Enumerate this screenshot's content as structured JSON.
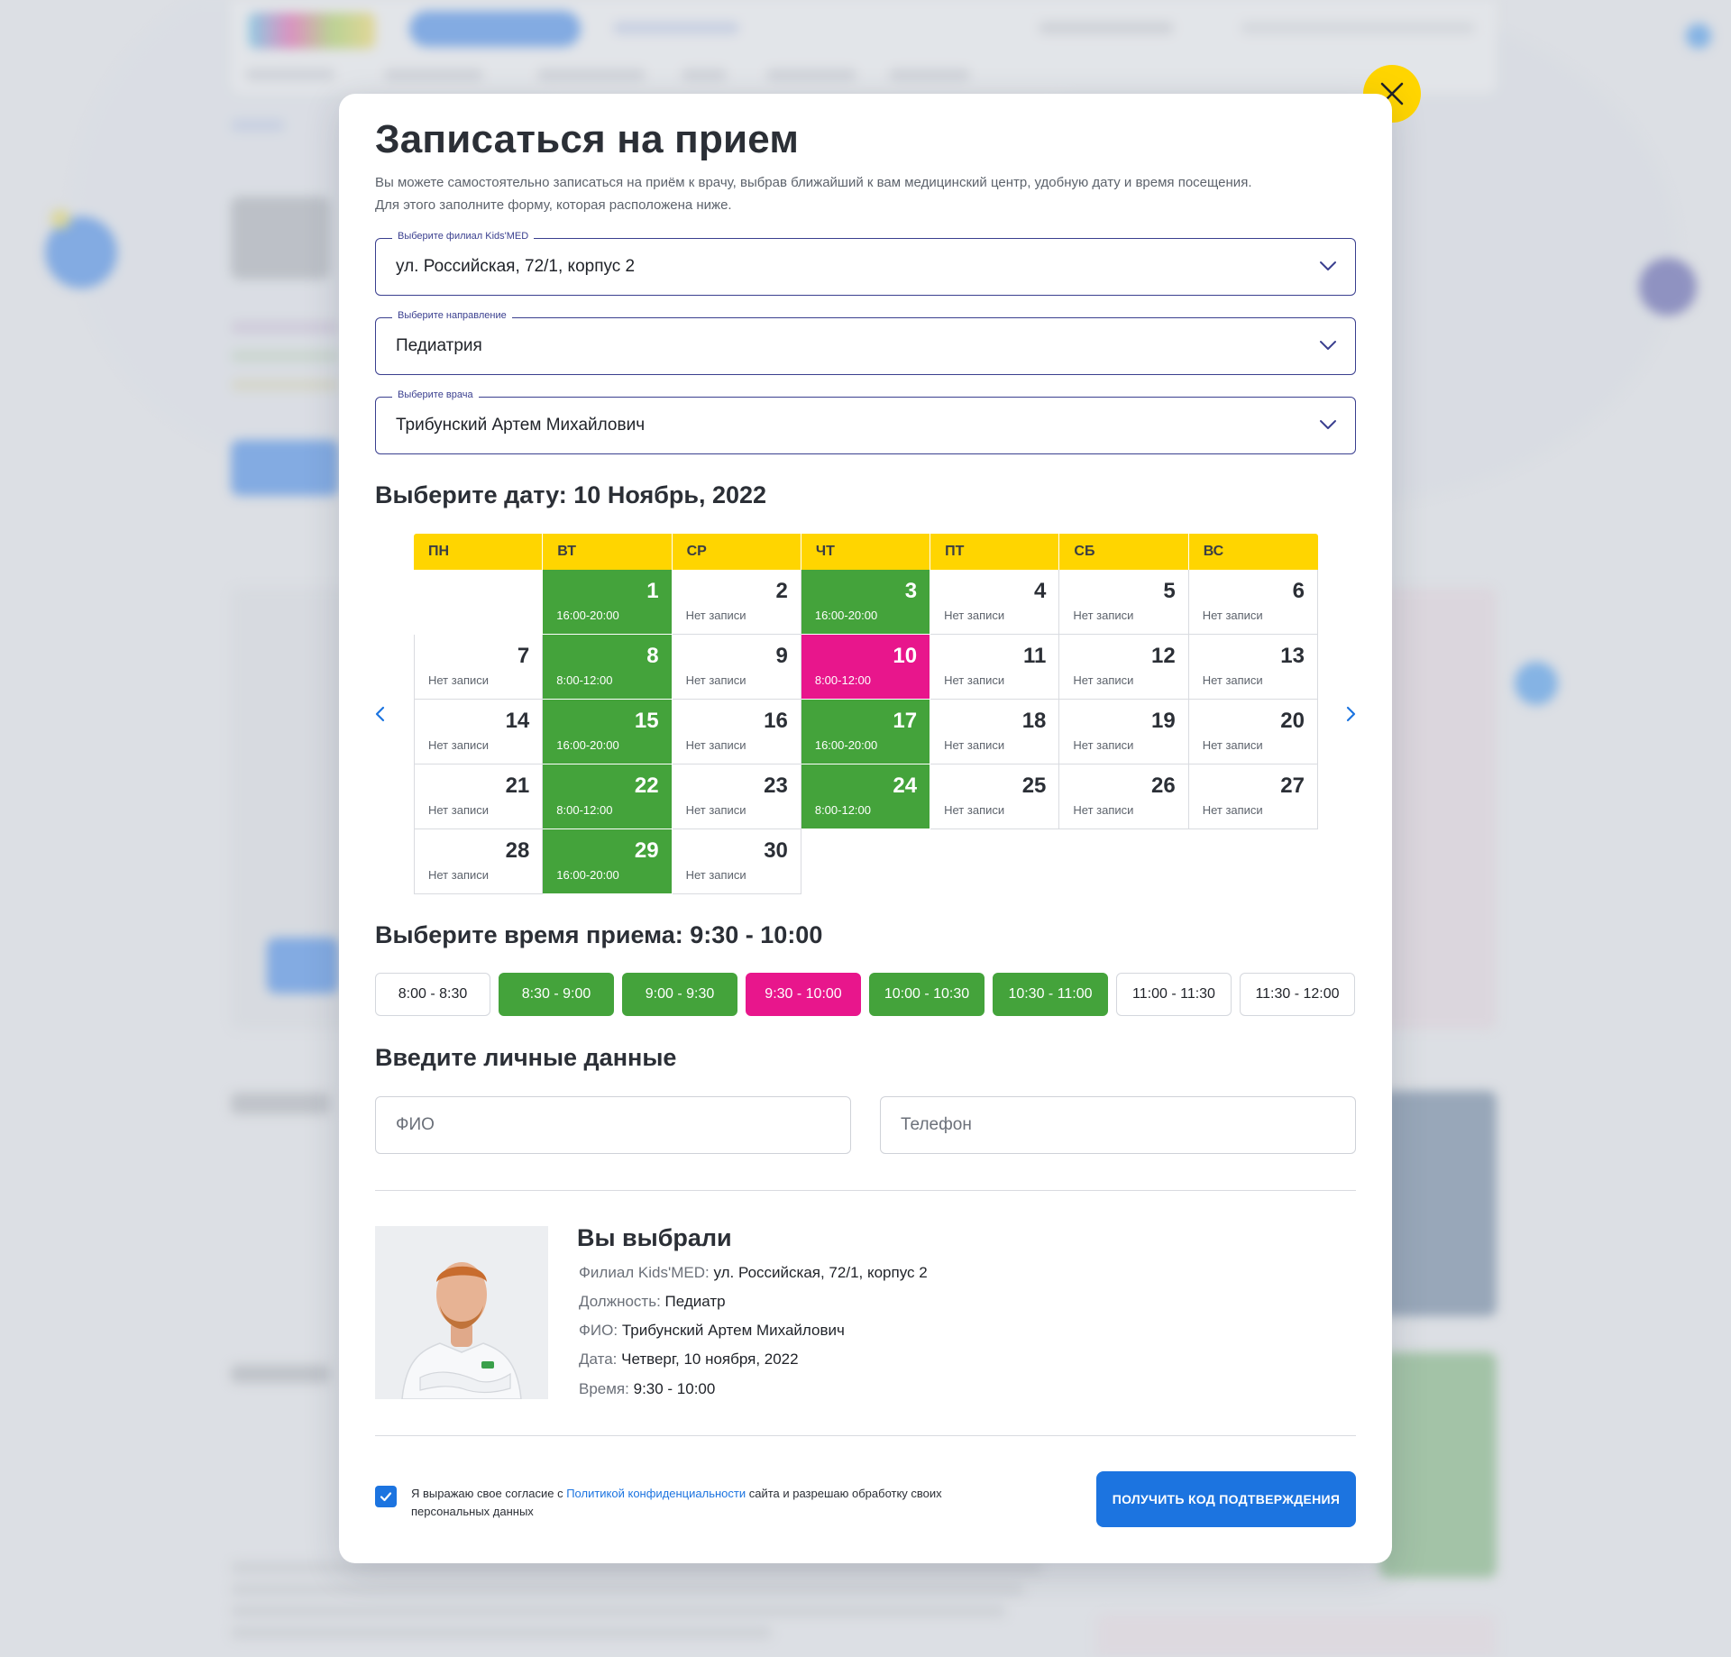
{
  "modal": {
    "title": "Записаться на прием",
    "description_line1": "Вы можете самостоятельно записаться на приём к врачу, выбрав ближайший к вам медицинский центр, удобную дату и время посещения.",
    "description_line2": "Для этого заполните форму, которая расположена ниже."
  },
  "selects": {
    "branch": {
      "label": "Выберите филиал Kids'MED",
      "value": "ул. Российская, 72/1, корпус 2"
    },
    "direction": {
      "label": "Выберите направление",
      "value": "Педиатрия"
    },
    "doctor": {
      "label": "Выберите врача",
      "value": "Трибунский Артем Михайлович"
    }
  },
  "date_section": {
    "title": "Выберите дату: 10 Ноябрь, 2022"
  },
  "calendar": {
    "weekdays": [
      "ПН",
      "ВТ",
      "СР",
      "ЧТ",
      "ПТ",
      "СБ",
      "ВС"
    ],
    "leading_empty": 1,
    "days": [
      {
        "day": "1",
        "note": "16:00-20:00",
        "status": "available"
      },
      {
        "day": "2",
        "note": "Нет записи",
        "status": "none"
      },
      {
        "day": "3",
        "note": "16:00-20:00",
        "status": "available"
      },
      {
        "day": "4",
        "note": "Нет записи",
        "status": "none"
      },
      {
        "day": "5",
        "note": "Нет записи",
        "status": "none"
      },
      {
        "day": "6",
        "note": "Нет записи",
        "status": "none"
      },
      {
        "day": "7",
        "note": "Нет записи",
        "status": "none"
      },
      {
        "day": "8",
        "note": "8:00-12:00",
        "status": "available"
      },
      {
        "day": "9",
        "note": "Нет записи",
        "status": "none"
      },
      {
        "day": "10",
        "note": "8:00-12:00",
        "status": "selected"
      },
      {
        "day": "11",
        "note": "Нет записи",
        "status": "none"
      },
      {
        "day": "12",
        "note": "Нет записи",
        "status": "none"
      },
      {
        "day": "13",
        "note": "Нет записи",
        "status": "none"
      },
      {
        "day": "14",
        "note": "Нет записи",
        "status": "none"
      },
      {
        "day": "15",
        "note": "16:00-20:00",
        "status": "available"
      },
      {
        "day": "16",
        "note": "Нет записи",
        "status": "none"
      },
      {
        "day": "17",
        "note": "16:00-20:00",
        "status": "available"
      },
      {
        "day": "18",
        "note": "Нет записи",
        "status": "none"
      },
      {
        "day": "19",
        "note": "Нет записи",
        "status": "none"
      },
      {
        "day": "20",
        "note": "Нет записи",
        "status": "none"
      },
      {
        "day": "21",
        "note": "Нет записи",
        "status": "none"
      },
      {
        "day": "22",
        "note": "8:00-12:00",
        "status": "available"
      },
      {
        "day": "23",
        "note": "Нет записи",
        "status": "none"
      },
      {
        "day": "24",
        "note": "8:00-12:00",
        "status": "available"
      },
      {
        "day": "25",
        "note": "Нет записи",
        "status": "none"
      },
      {
        "day": "26",
        "note": "Нет записи",
        "status": "none"
      },
      {
        "day": "27",
        "note": "Нет записи",
        "status": "none"
      },
      {
        "day": "28",
        "note": "Нет записи",
        "status": "none"
      },
      {
        "day": "29",
        "note": "16:00-20:00",
        "status": "available"
      },
      {
        "day": "30",
        "note": "Нет записи",
        "status": "none"
      }
    ]
  },
  "time_section": {
    "title": "Выберите время приема: 9:30 - 10:00"
  },
  "time_slots": [
    {
      "label": "8:00 - 8:30",
      "status": "none"
    },
    {
      "label": "8:30 - 9:00",
      "status": "available"
    },
    {
      "label": "9:00 - 9:30",
      "status": "available"
    },
    {
      "label": "9:30 - 10:00",
      "status": "selected"
    },
    {
      "label": "10:00 - 10:30",
      "status": "available"
    },
    {
      "label": "10:30 - 11:00",
      "status": "available"
    },
    {
      "label": "11:00 - 11:30",
      "status": "none"
    },
    {
      "label": "11:30 - 12:00",
      "status": "none"
    }
  ],
  "personal": {
    "title": "Введите личные данные",
    "name_placeholder": "ФИО",
    "phone_placeholder": "Телефон"
  },
  "summary": {
    "title": "Вы выбрали",
    "lines": [
      {
        "label": "Филиал Kids'MED:",
        "value": "ул. Российская, 72/1, корпус 2"
      },
      {
        "label": "Должность:",
        "value": "Педиатр"
      },
      {
        "label": "ФИО:",
        "value": "Трибунский Артем Михайлович"
      },
      {
        "label": "Дата:",
        "value": "Четверг, 10 ноября, 2022"
      },
      {
        "label": "Время:",
        "value": "9:30 - 10:00"
      }
    ]
  },
  "consent": {
    "checked": true,
    "text_before": "Я выражаю свое согласие с ",
    "link_text": "Политикой конфиденциальности",
    "text_after": " сайта и разрешаю обработку своих персональных данных"
  },
  "submit": {
    "label": "ПОЛУЧИТЬ КОД ПОДТВЕРЖДЕНИЯ"
  },
  "colors": {
    "accent_yellow": "#ffd500",
    "available_green": "#44a33b",
    "selected_pink": "#e8168c",
    "primary_blue": "#1c74e0",
    "select_border": "#3a3f8f"
  },
  "icons": {
    "close": "close-icon",
    "dropdown": "chevron-down-icon",
    "prev": "chevron-left-icon",
    "next": "chevron-right-icon",
    "check": "check-icon"
  }
}
